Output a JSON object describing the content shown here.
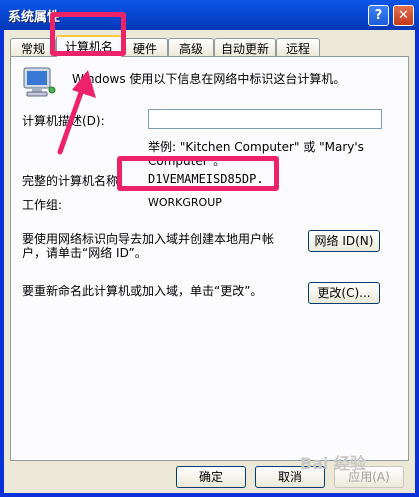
{
  "window": {
    "title": "系统属性",
    "help_glyph": "?",
    "close_glyph": "✕"
  },
  "tabs": [
    {
      "label": "常规"
    },
    {
      "label": "计算机名",
      "active": true
    },
    {
      "label": "硬件"
    },
    {
      "label": "高级"
    },
    {
      "label": "自动更新"
    },
    {
      "label": "远程"
    }
  ],
  "panel": {
    "intro": "Windows 使用以下信息在网络中标识这台计算机。",
    "description_label": "计算机描述(D):",
    "description_value": "",
    "example_line1": "举例: \"Kitchen Computer\" 或 \"Mary's",
    "example_line2": "Computer\"。",
    "full_name_label": "完整的计算机名称:",
    "full_name_value": "D1VEMAMEISD85DP.",
    "workgroup_label": "工作组:",
    "workgroup_value": "WORKGROUP",
    "network_id_text_line1": "要使用网络标识向导去加入域并创建本地用户帐",
    "network_id_text_line2": "户，请单击“网络 ID”。",
    "network_id_button": "网络 ID(N)",
    "rename_text": "要重新命名此计算机或加入域，单击“更改”。",
    "change_button": "更改(C)..."
  },
  "footer": {
    "ok_button": "确定",
    "cancel_button": "取消",
    "apply_button": "应用(A)"
  },
  "watermark": "Bai 经验",
  "colors": {
    "annotation": "#ee2268",
    "titlebar": "#0846d0",
    "dialog_bg": "#ece9d8"
  }
}
